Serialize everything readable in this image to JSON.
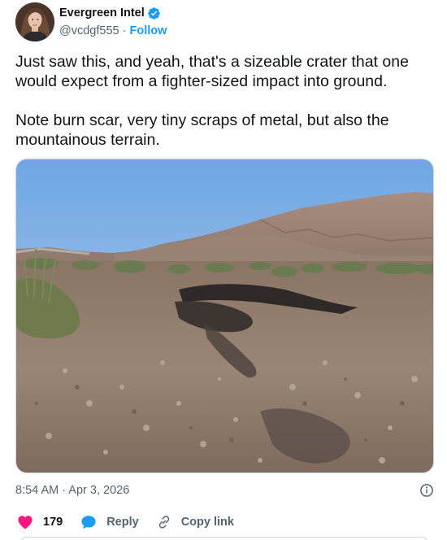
{
  "author": {
    "name": "Evergreen Intel",
    "handle": "@vcdgf555",
    "separator": "·",
    "follow_label": "Follow",
    "verified": true
  },
  "tweet": {
    "text": "Just saw this, and yeah, that's a sizeable crater that one would expect from a fighter-sized impact into ground.\n\nNote burn scar, very tiny scraps of metal, but also the mountainous terrain.",
    "timestamp": "8:54 AM · Apr 3, 2026"
  },
  "actions": {
    "like_count": "179",
    "reply_label": "Reply",
    "copy_link_label": "Copy link"
  },
  "icons": {
    "verified": "verified-badge-icon",
    "info": "info-icon",
    "like": "heart-icon",
    "reply": "speech-bubble-icon",
    "copy_link": "link-icon"
  },
  "colors": {
    "accent": "#1d9bf0",
    "like": "#f91880",
    "text": "#0f1419",
    "secondary": "#536471"
  }
}
